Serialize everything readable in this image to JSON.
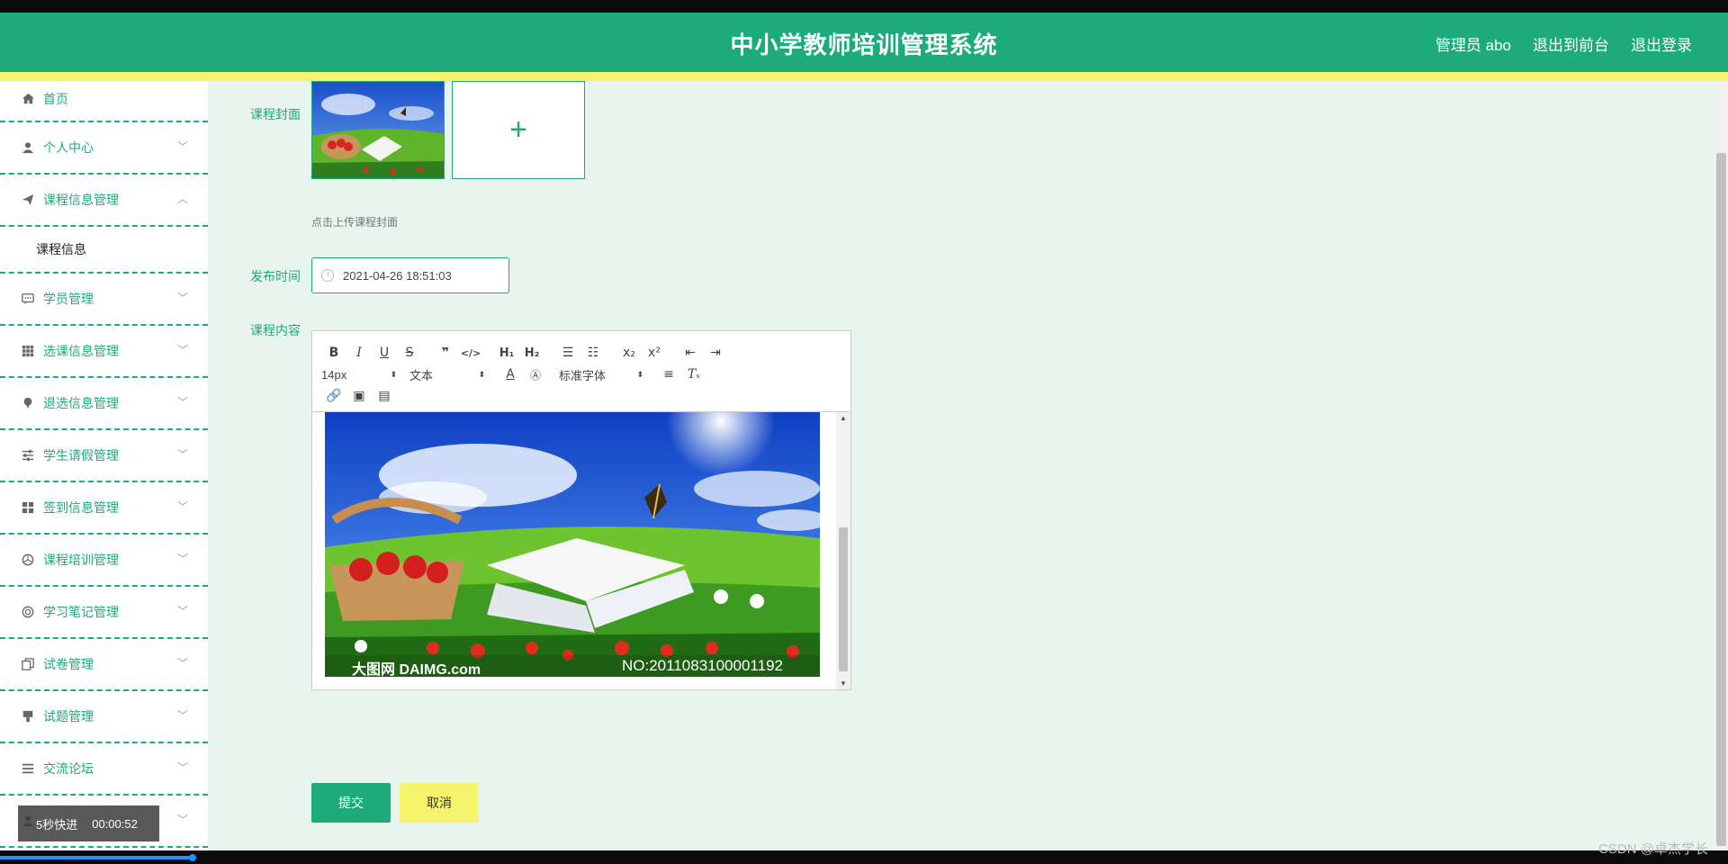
{
  "header": {
    "title": "中小学教师培训管理系统",
    "user_label": "管理员 abo",
    "to_front": "退出到前台",
    "logout": "退出登录"
  },
  "sidebar": {
    "items": [
      {
        "label": "首页",
        "icon": "home-icon"
      },
      {
        "label": "个人中心",
        "icon": "user-icon"
      },
      {
        "label": "课程信息管理",
        "icon": "send-icon",
        "expanded": true
      },
      {
        "label": "学员管理",
        "icon": "chat-icon"
      },
      {
        "label": "选课信息管理",
        "icon": "grid-icon"
      },
      {
        "label": "退选信息管理",
        "icon": "pin-icon"
      },
      {
        "label": "学生请假管理",
        "icon": "sliders-icon"
      },
      {
        "label": "签到信息管理",
        "icon": "blocks-icon"
      },
      {
        "label": "课程培训管理",
        "icon": "aperture-icon"
      },
      {
        "label": "学习笔记管理",
        "icon": "lifebuoy-icon"
      },
      {
        "label": "试卷管理",
        "icon": "copy-icon"
      },
      {
        "label": "试题管理",
        "icon": "tag-icon"
      },
      {
        "label": "交流论坛",
        "icon": "menu-icon"
      },
      {
        "label": "",
        "icon": "user-icon"
      }
    ],
    "submenu_label": "课程信息"
  },
  "form": {
    "cover_label": "课程封面",
    "cover_hint": "点击上传课程封面",
    "publish_time_label": "发布时间",
    "publish_time_value": "2021-04-26 18:51:03",
    "content_label": "课程内容",
    "image_watermark_left": "大图网 DAIMG.com",
    "image_watermark_right": "NO:2011083100001192"
  },
  "editor": {
    "font_size": "14px",
    "text_type": "文本",
    "font_family": "标准字体"
  },
  "buttons": {
    "submit": "提交",
    "cancel": "取消"
  },
  "video": {
    "skip": "5秒快进",
    "time": "00:00:52"
  },
  "watermark": "CSDN @卓杰学长",
  "colors": {
    "primary": "#1dab7b",
    "accent_yellow": "#f6f46d",
    "content_bg": "#e8f5ef"
  }
}
